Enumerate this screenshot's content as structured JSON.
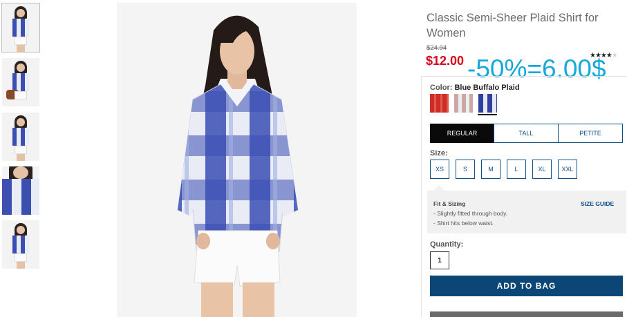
{
  "thumbnails": [
    {
      "alt": "front view",
      "selected": true
    },
    {
      "alt": "with bag",
      "selected": false
    },
    {
      "alt": "full body",
      "selected": false
    },
    {
      "alt": "close up",
      "selected": false
    },
    {
      "alt": "side view",
      "selected": false
    }
  ],
  "product": {
    "title": "Classic Semi-Sheer Plaid Shirt for Women",
    "old_price": "$24.94",
    "price": "$12.00",
    "rating_stars": 4,
    "rating_max": 5
  },
  "overlay": {
    "discount_text": "-50%=6.00$",
    "color": "#16a8dd"
  },
  "color": {
    "label": "Color:",
    "value": "Blue Buffalo Plaid",
    "swatches": [
      {
        "name": "red plaid",
        "color": "#e66a62"
      },
      {
        "name": "pink grey plaid",
        "color": "#cfa6a6"
      },
      {
        "name": "blue buffalo plaid",
        "color": "#2f3f9e",
        "selected": true
      }
    ]
  },
  "fit_tabs": [
    {
      "label": "REGULAR",
      "active": true
    },
    {
      "label": "TALL",
      "active": false
    },
    {
      "label": "PETITE",
      "active": false
    }
  ],
  "size": {
    "label": "Size:",
    "options": [
      "XS",
      "S",
      "M",
      "L",
      "XL",
      "XXL"
    ]
  },
  "fit_sizing": {
    "title": "Fit & Sizing",
    "size_guide": "SIZE GUIDE",
    "notes": [
      "- Slightly fitted through body.",
      "- Shirt hits below waist."
    ]
  },
  "quantity": {
    "label": "Quantity:",
    "value": "1"
  },
  "add_to_bag": "ADD TO BAG",
  "colors": {
    "price_red": "#d9001b",
    "brand_blue": "#0b4677",
    "active_tab": "#0a0a0a"
  }
}
